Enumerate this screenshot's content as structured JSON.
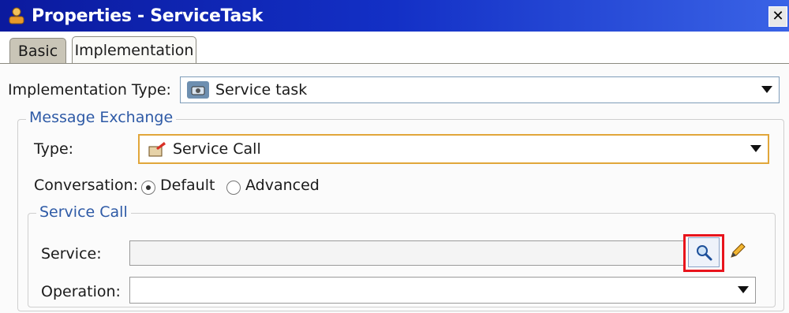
{
  "window": {
    "title": "Properties - ServiceTask",
    "close_icon": "close-icon"
  },
  "tabs": [
    {
      "label": "Basic"
    },
    {
      "label": "Implementation"
    }
  ],
  "implementation": {
    "type_label": "Implementation Type:",
    "type_value": "Service task"
  },
  "message_exchange": {
    "legend": "Message Exchange",
    "type_label": "Type:",
    "type_value": "Service Call",
    "conversation_label": "Conversation:",
    "options": [
      {
        "label": "Default",
        "selected": true
      },
      {
        "label": "Advanced",
        "selected": false
      }
    ]
  },
  "service_call": {
    "legend": "Service Call",
    "service_label": "Service:",
    "service_value": "",
    "operation_label": "Operation:",
    "operation_value": ""
  },
  "colors": {
    "title_bar": "#1330c6",
    "legend_text": "#2e5aa6",
    "highlight": "#e8141c"
  }
}
